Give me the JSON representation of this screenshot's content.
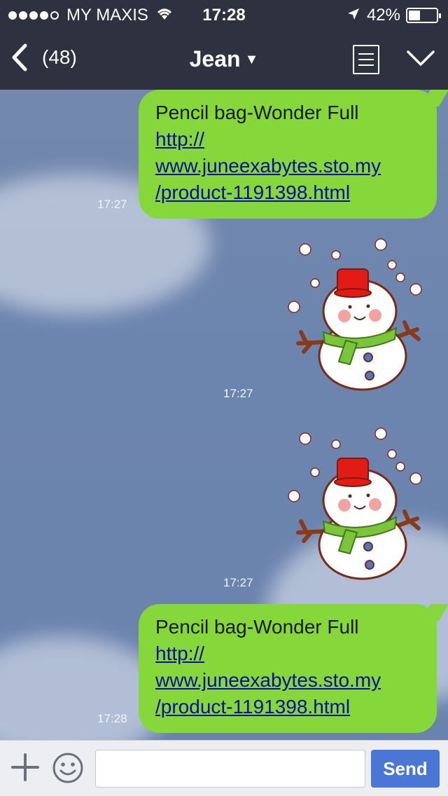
{
  "status_bar": {
    "carrier": "MY MAXIS",
    "time": "17:28",
    "battery_percent": "42%",
    "battery_level": 0.42
  },
  "nav": {
    "unread_count": "(48)",
    "contact_name": "Jean"
  },
  "messages": [
    {
      "type": "text",
      "line1": "Pencil bag-Wonder Full",
      "link": [
        "http://",
        "www.juneexabytes.sto.my",
        "/product-1191398.html"
      ],
      "time": "17:27"
    },
    {
      "type": "sticker",
      "name": "snowman-sticker",
      "time": "17:27"
    },
    {
      "type": "sticker",
      "name": "snowman-sticker",
      "time": "17:27"
    },
    {
      "type": "text",
      "line1": "Pencil bag-Wonder Full",
      "link": [
        "http://",
        "www.juneexabytes.sto.my",
        "/product-1191398.html"
      ],
      "time": "17:28"
    }
  ],
  "input_bar": {
    "placeholder": "",
    "send_label": "Send"
  },
  "colors": {
    "header_bg": "#2d3140",
    "bubble_green": "#86d83a",
    "send_blue": "#4a77d6",
    "chat_bg": "#6e86ad"
  }
}
